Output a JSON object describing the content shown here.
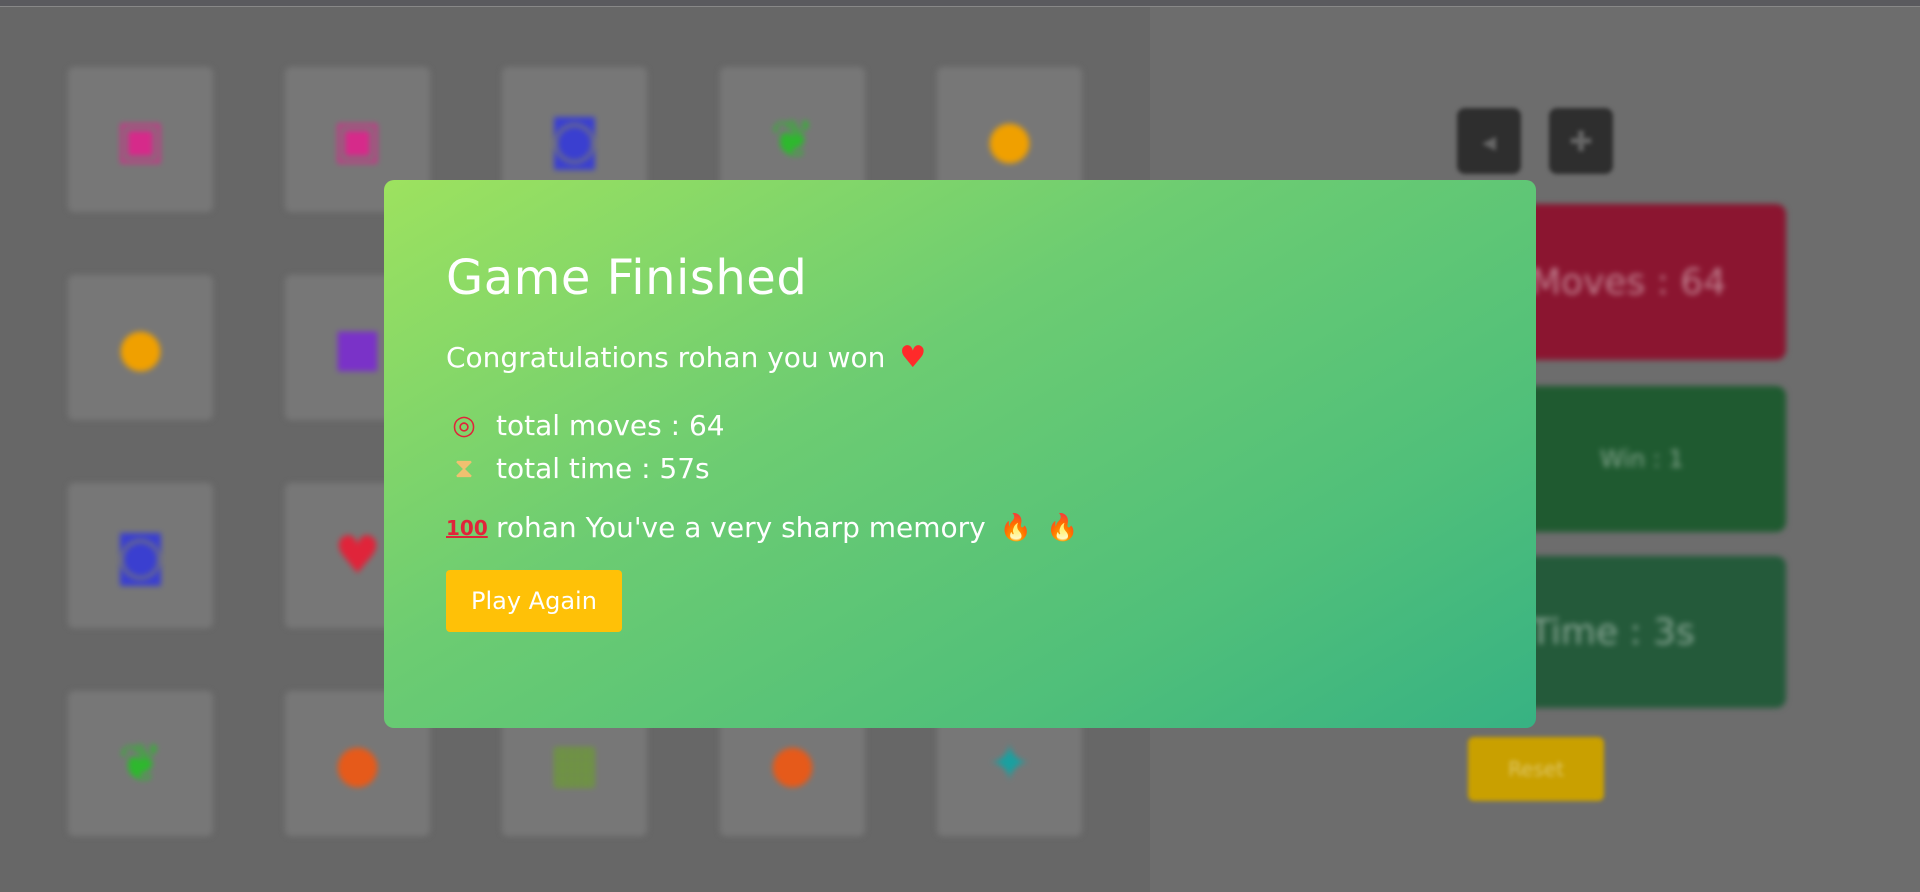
{
  "board": {
    "cards": [
      {
        "icon": "instagram-icon",
        "glyph": "▣",
        "color": "#d62a8a"
      },
      {
        "icon": "instagram-icon",
        "glyph": "▣",
        "color": "#d62a8a"
      },
      {
        "icon": "camera-icon",
        "glyph": "◙",
        "color": "#3a3fd0"
      },
      {
        "icon": "seedling-icon",
        "glyph": "❦",
        "color": "#2eb82e"
      },
      {
        "icon": "lightbulb-icon",
        "glyph": "●",
        "color": "#f0a000"
      },
      {
        "icon": "lightbulb-icon",
        "glyph": "●",
        "color": "#f0a000"
      },
      {
        "icon": "purple-square-icon",
        "glyph": "■",
        "color": "#7a32c8"
      },
      {
        "icon": "hidden-card",
        "glyph": "",
        "color": "#777"
      },
      {
        "icon": "hidden-card",
        "glyph": "",
        "color": "#777"
      },
      {
        "icon": "hidden-card",
        "glyph": "",
        "color": "#777"
      },
      {
        "icon": "camera-icon",
        "glyph": "◙",
        "color": "#3a3fd0"
      },
      {
        "icon": "heart-icon",
        "glyph": "♥",
        "color": "#e0243a"
      },
      {
        "icon": "hidden-card",
        "glyph": "",
        "color": "#777"
      },
      {
        "icon": "hidden-card",
        "glyph": "",
        "color": "#777"
      },
      {
        "icon": "hidden-card",
        "glyph": "",
        "color": "#777"
      },
      {
        "icon": "seedling-icon",
        "glyph": "❦",
        "color": "#2eb82e"
      },
      {
        "icon": "fire-icon",
        "glyph": "●",
        "color": "#e65a1a"
      },
      {
        "icon": "map-icon",
        "glyph": "▦",
        "color": "#6aa02a"
      },
      {
        "icon": "fire-icon",
        "glyph": "●",
        "color": "#e65a1a"
      },
      {
        "icon": "puzzle-icon",
        "glyph": "✦",
        "color": "#1aa0a0"
      }
    ]
  },
  "sidebar": {
    "moves_label": "Moves : 64",
    "wins_label": "Win : 1",
    "time_label": "Time : 3s",
    "reset_label": "Reset"
  },
  "modal": {
    "title": "Game Finished",
    "congrats": "Congratulations rohan you won",
    "moves_line": "total moves : 64",
    "time_line": "total time : 57s",
    "sharp_line": "rohan You've a very sharp memory",
    "play_again": "Play Again"
  },
  "colors": {
    "modal_gradient_start": "#9de25f",
    "modal_gradient_end": "#37b283",
    "play_button": "#ffc107",
    "moves_card": "#8b1530",
    "wins_card": "#1f5a30",
    "time_card": "#245a3a"
  }
}
